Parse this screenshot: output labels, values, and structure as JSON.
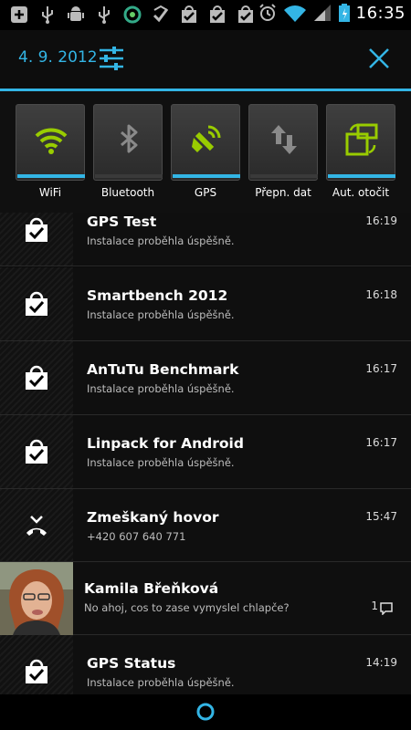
{
  "statusbar": {
    "time": "16:35",
    "left_icons": [
      "add-icon",
      "usb-icon",
      "android-debug-icon",
      "usb-icon",
      "sync-icon",
      "play-store-icon",
      "check-bag-icon",
      "check-bag-icon",
      "check-bag-icon"
    ],
    "right_icons": [
      "alarm-icon",
      "wifi-icon",
      "signal-icon",
      "battery-charging-icon"
    ]
  },
  "header": {
    "date": "4. 9. 2012"
  },
  "toggles": [
    {
      "label": "WiFi",
      "icon": "wifi-icon",
      "active": true
    },
    {
      "label": "Bluetooth",
      "icon": "bluetooth-icon",
      "active": false
    },
    {
      "label": "GPS",
      "icon": "gps-icon",
      "active": true
    },
    {
      "label": "Přepn. dat",
      "icon": "data-transfer-icon",
      "active": false
    },
    {
      "label": "Aut. otočit",
      "icon": "auto-rotate-icon",
      "active": true
    }
  ],
  "notifications": [
    {
      "title": "GPS Test",
      "text": "Instalace proběhla úspěšně.",
      "time": "16:19",
      "icon": "check-bag-icon"
    },
    {
      "title": "Smartbench 2012",
      "text": "Instalace proběhla úspěšně.",
      "time": "16:18",
      "icon": "check-bag-icon"
    },
    {
      "title": "AnTuTu Benchmark",
      "text": "Instalace proběhla úspěšně.",
      "time": "16:17",
      "icon": "check-bag-icon"
    },
    {
      "title": "Linpack for Android",
      "text": "Instalace proběhla úspěšně.",
      "time": "16:17",
      "icon": "check-bag-icon"
    },
    {
      "title": "Zmeškaný hovor",
      "text": "+420 607 640 771",
      "time": "15:47",
      "icon": "missed-call-icon"
    },
    {
      "title": "Kamila Břeňková",
      "text": "No ahoj, cos to zase vymyslel chlapče?",
      "count": "1",
      "icon": "chat-icon"
    },
    {
      "title": "GPS Status",
      "text": "Instalace proběhla úspěšně.",
      "time": "14:19",
      "icon": "check-bag-icon"
    }
  ],
  "colors": {
    "accent": "#33b5e5",
    "toggle_active": "#99cc00"
  }
}
